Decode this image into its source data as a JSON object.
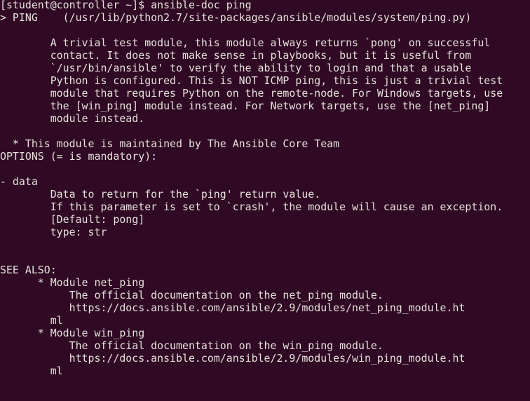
{
  "terminal": {
    "lines": [
      "[student@controller ~]$ ansible-doc ping",
      "> PING    (/usr/lib/python2.7/site-packages/ansible/modules/system/ping.py)",
      "",
      "        A trivial test module, this module always returns `pong' on successful",
      "        contact. It does not make sense in playbooks, but it is useful from",
      "        `/usr/bin/ansible' to verify the ability to login and that a usable",
      "        Python is configured. This is NOT ICMP ping, this is just a trivial test",
      "        module that requires Python on the remote-node. For Windows targets, use",
      "        the [win_ping] module instead. For Network targets, use the [net_ping]",
      "        module instead.",
      "",
      "  * This module is maintained by The Ansible Core Team",
      "OPTIONS (= is mandatory):",
      "",
      "- data",
      "        Data to return for the `ping' return value.",
      "        If this parameter is set to `crash', the module will cause an exception.",
      "        [Default: pong]",
      "        type: str",
      "",
      "",
      "SEE ALSO:",
      "      * Module net_ping",
      "           The official documentation on the net_ping module.",
      "           https://docs.ansible.com/ansible/2.9/modules/net_ping_module.ht",
      "        ml",
      "      * Module win_ping",
      "           The official documentation on the win_ping module.",
      "           https://docs.ansible.com/ansible/2.9/modules/win_ping_module.ht",
      "        ml"
    ]
  }
}
